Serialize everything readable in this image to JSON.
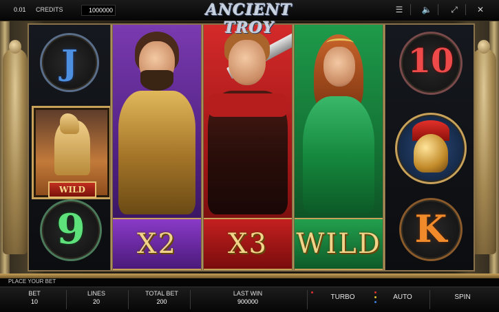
{
  "top_bar": {
    "bet_value": "0.01",
    "credits_label": "CREDITS",
    "credits_value": "1000000"
  },
  "title": "ANCIENT TROY",
  "icons": {
    "menu": "menu-icon",
    "sound": "speaker-icon",
    "fullscreen": "fullscreen-icon",
    "close": "close-icon"
  },
  "reels": {
    "reel1": [
      "J",
      "WILD",
      "9"
    ],
    "reel2_multiplier": "X2",
    "reel3_multiplier": "X3",
    "reel4_label": "WILD",
    "reel5": [
      "10",
      "helmet",
      "K"
    ]
  },
  "wild_label": "WILD",
  "message": "PLACE YOUR BET",
  "bottom": {
    "bet_label": "BET",
    "bet_value": "10",
    "lines_label": "LINES",
    "lines_value": "20",
    "total_bet_label": "TOTAL BET",
    "total_bet_value": "200",
    "last_win_label": "LAST WIN",
    "last_win_value": "900000",
    "turbo_label": "TURBO",
    "auto_label": "AUTO",
    "spin_label": "SPIN"
  },
  "colors": {
    "gold": "#c9a25a",
    "purple_panel": "#5a2a8a",
    "red_panel": "#b01e1e",
    "green_panel": "#1e7a3a"
  }
}
